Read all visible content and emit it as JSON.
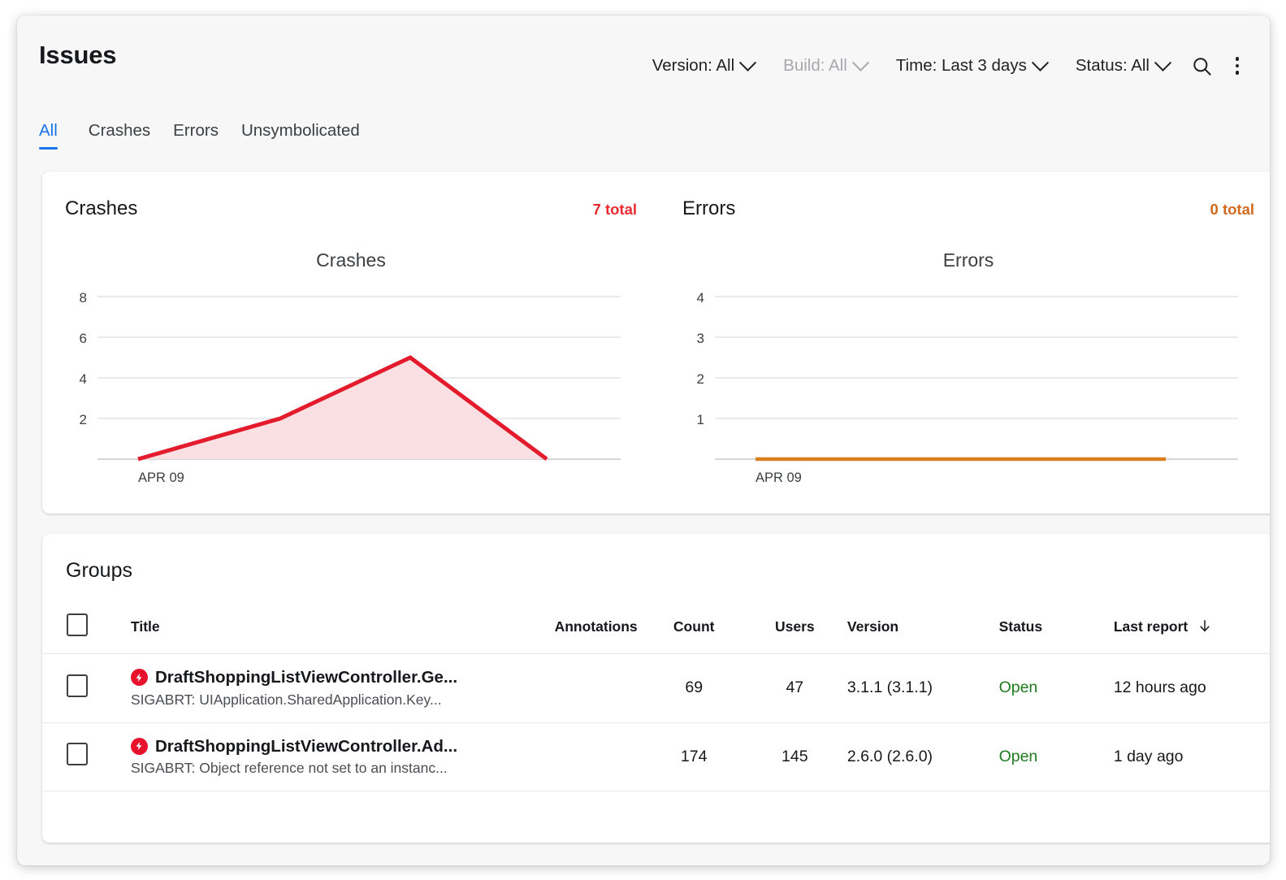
{
  "header": {
    "title": "Issues",
    "filters": [
      {
        "label": "Version: All",
        "disabled": false,
        "name": "version-filter"
      },
      {
        "label": "Build: All",
        "disabled": true,
        "name": "build-filter"
      },
      {
        "label": "Time: Last 3 days",
        "disabled": false,
        "name": "time-filter"
      },
      {
        "label": "Status: All",
        "disabled": false,
        "name": "status-filter"
      }
    ],
    "search_icon": "search-icon",
    "overflow_icon": "more-vertical-icon"
  },
  "tabs": [
    {
      "label": "All",
      "active": true
    },
    {
      "label": "Crashes",
      "active": false
    },
    {
      "label": "Errors",
      "active": false
    },
    {
      "label": "Unsymbolicated",
      "active": false
    }
  ],
  "crashes_card": {
    "name": "Crashes",
    "total": "7 total",
    "total_color": "#ea2b33"
  },
  "errors_card": {
    "name": "Errors",
    "total": "0 total",
    "total_color": "#d2691e"
  },
  "groups": {
    "title": "Groups",
    "columns": {
      "title": "Title",
      "annotations": "Annotations",
      "count": "Count",
      "users": "Users",
      "version": "Version",
      "status": "Status",
      "last_report": "Last report"
    },
    "sort_icon": "arrow-down-icon",
    "rows": [
      {
        "title": "DraftShoppingListViewController.Ge...",
        "subtitle": "SIGABRT: UIApplication.SharedApplication.Key...",
        "icon": "crash-icon",
        "annotations": "",
        "count": "69",
        "users": "47",
        "version": "3.1.1 (3.1.1)",
        "status": "Open",
        "last_report": "12 hours ago"
      },
      {
        "title": "DraftShoppingListViewController.Ad...",
        "subtitle": "SIGABRT: Object reference not set to an instanc...",
        "icon": "crash-icon",
        "annotations": "",
        "count": "174",
        "users": "145",
        "version": "2.6.0 (2.6.0)",
        "status": "Open",
        "last_report": "1 day ago"
      }
    ]
  },
  "chart_data": [
    {
      "type": "area",
      "title": "Crashes",
      "xlabel": "",
      "ylabel": "",
      "x": [
        "APR 09",
        "",
        "",
        ""
      ],
      "tick_labels_x": [
        "APR 09"
      ],
      "values": [
        0,
        2,
        5,
        0
      ],
      "yticks": [
        2,
        4,
        6,
        8
      ],
      "ylim": [
        0,
        8
      ],
      "grid": true,
      "legend": "none",
      "line_color": "#e31b2d",
      "fill_color": "#fbe0e3"
    },
    {
      "type": "area",
      "title": "Errors",
      "xlabel": "",
      "ylabel": "",
      "x": [
        "APR 09",
        "",
        "",
        ""
      ],
      "tick_labels_x": [
        "APR 09"
      ],
      "values": [
        0,
        0,
        0,
        0
      ],
      "yticks": [
        1,
        2,
        3,
        4
      ],
      "ylim": [
        0,
        4
      ],
      "grid": true,
      "legend": "none",
      "line_color": "#d9801e",
      "fill_color": "#ffffff"
    }
  ]
}
